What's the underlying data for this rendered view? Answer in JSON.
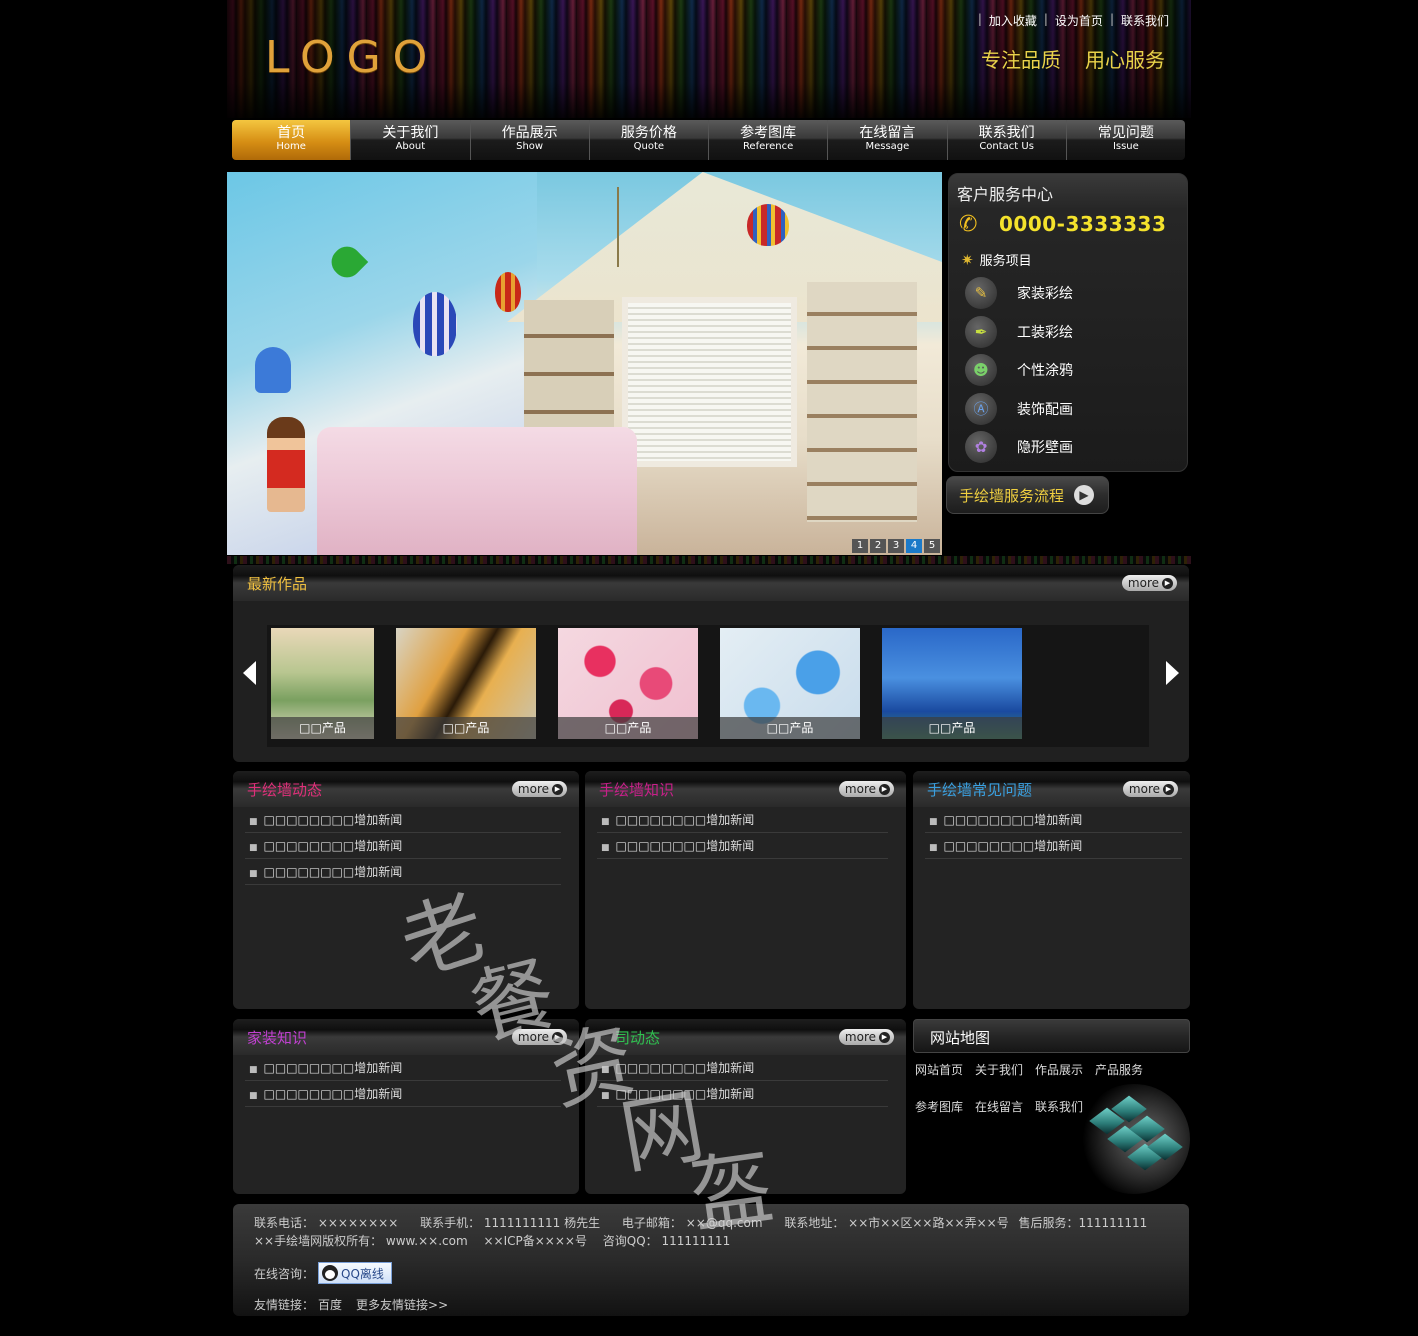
{
  "header": {
    "logo": "LOGO",
    "top_links": [
      "加入收藏",
      "设为首页",
      "联系我们"
    ],
    "slogans": [
      "专注品质",
      "用心服务"
    ]
  },
  "nav": [
    {
      "cn": "首页",
      "en": "Home",
      "active": true
    },
    {
      "cn": "关于我们",
      "en": "About"
    },
    {
      "cn": "作品展示",
      "en": "Show"
    },
    {
      "cn": "服务价格",
      "en": "Quote"
    },
    {
      "cn": "参考图库",
      "en": "Reference"
    },
    {
      "cn": "在线留言",
      "en": "Message"
    },
    {
      "cn": "联系我们",
      "en": "Contact Us"
    },
    {
      "cn": "常见问题",
      "en": "Issue"
    }
  ],
  "banner": {
    "slides": [
      "1",
      "2",
      "3",
      "4",
      "5"
    ],
    "active_slide": "4"
  },
  "service": {
    "title": "客户服务中心",
    "phone": "0000-3333333",
    "subhead": "服务项目",
    "items": [
      {
        "label": "家装彩绘",
        "icon": "pencil-icon"
      },
      {
        "label": "工装彩绘",
        "icon": "pen-nib-icon"
      },
      {
        "label": "个性涂鸦",
        "icon": "face-icon"
      },
      {
        "label": "装饰配画",
        "icon": "app-store-icon"
      },
      {
        "label": "隐形壁画",
        "icon": "palette-icon"
      }
    ],
    "flow_button": "手绘墙服务流程"
  },
  "works": {
    "title": "最新作品",
    "more": "more",
    "items": [
      {
        "caption": "□□产品"
      },
      {
        "caption": "□□产品"
      },
      {
        "caption": "□□产品"
      },
      {
        "caption": "□□产品"
      },
      {
        "caption": "□□产品"
      }
    ]
  },
  "panels": {
    "news": {
      "title": "手绘墙动态",
      "more": "more",
      "items": [
        "□□□□□□□□增加新闻",
        "□□□□□□□□增加新闻",
        "□□□□□□□□增加新闻"
      ]
    },
    "knowledge": {
      "title": "手绘墙知识",
      "more": "more",
      "items": [
        "□□□□□□□□增加新闻",
        "□□□□□□□□增加新闻"
      ]
    },
    "faq": {
      "title": "手绘墙常见问题",
      "more": "more",
      "items": [
        "□□□□□□□□增加新闻",
        "□□□□□□□□增加新闻"
      ]
    },
    "home": {
      "title": "家装知识",
      "more": "more",
      "items": [
        "□□□□□□□□增加新闻",
        "□□□□□□□□增加新闻"
      ]
    },
    "company": {
      "title": "司动态",
      "more": "more",
      "items": [
        "□□□□□□□□增加新闻",
        "□□□□□□□□增加新闻"
      ]
    }
  },
  "sitemap": {
    "title": "网站地图",
    "links": [
      "网站首页",
      "关于我们",
      "作品展示",
      "产品服务",
      "参考图库",
      "在线留言",
      "联系我们"
    ]
  },
  "footer": {
    "tel": "联系电话： ××××××××",
    "mobile": "联系手机： 1111111111 杨先生",
    "email": "电子邮箱： ××@qq.com",
    "address": "联系地址： ××市××区××路××弄××号",
    "after_sales": "售后服务：111111111",
    "copyright": "××手绘墙网版权所有： www.××.com",
    "icp": "××ICP备××××号",
    "qq": "咨询QQ： 111111111",
    "online_label": "在线咨询：",
    "qq_button": "QQ离线",
    "friends_label": "友情链接：",
    "friends": [
      "百度",
      "更多友情链接>>"
    ]
  },
  "watermark": [
    "老",
    "餐",
    "资",
    "网",
    "盔"
  ],
  "colors": {
    "accent_gold": "#e0a23a",
    "slogan_yellow": "#e9d34a",
    "news_pink": "#e0307a",
    "knowledge_magenta": "#c8208a",
    "faq_blue": "#3aa0e0",
    "home_purple": "#c040d0",
    "company_green": "#30c050"
  }
}
